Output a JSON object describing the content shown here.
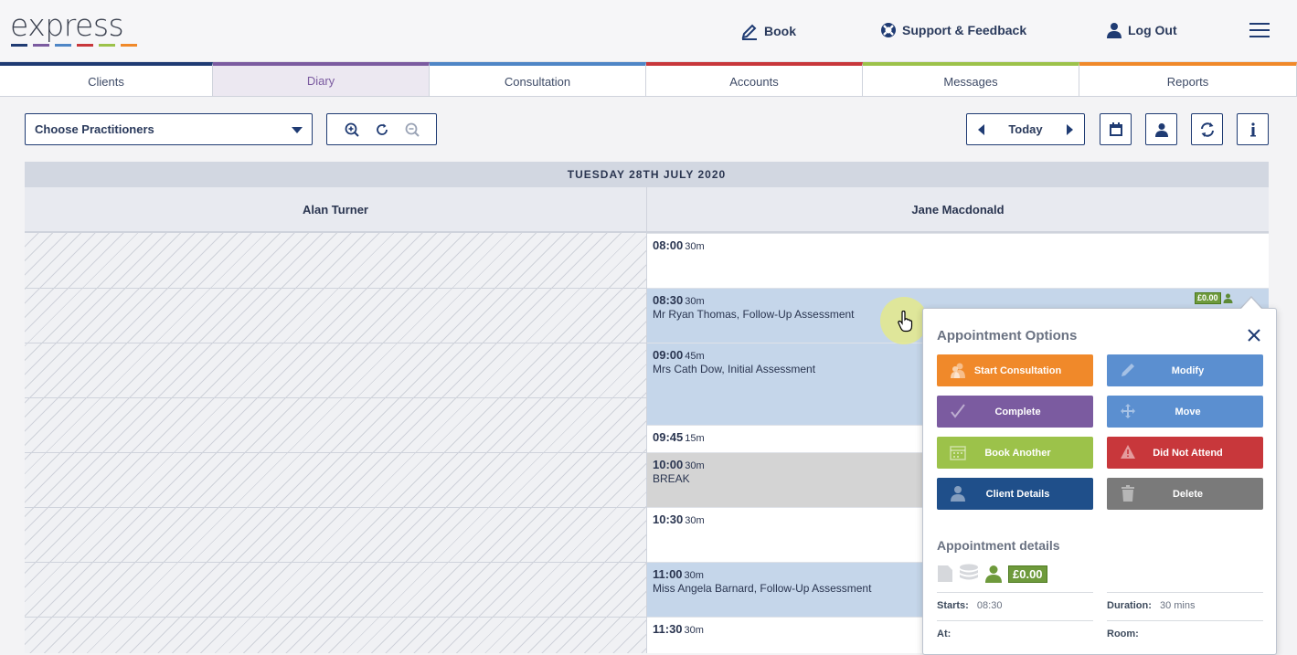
{
  "header": {
    "logo_text": "express",
    "logo_colors": [
      "#1f3b73",
      "#7b5ba0",
      "#4f86c6",
      "#c8373b",
      "#9cc24a",
      "#f0892a"
    ],
    "book_label": "Book",
    "support_label": "Support & Feedback",
    "logout_label": "Log Out"
  },
  "tabs": [
    {
      "label": "Clients",
      "color": "#1f3b73"
    },
    {
      "label": "Diary",
      "color": "#7b5ba0"
    },
    {
      "label": "Consultation",
      "color": "#4f86c6"
    },
    {
      "label": "Accounts",
      "color": "#c8373b"
    },
    {
      "label": "Messages",
      "color": "#9cc24a"
    },
    {
      "label": "Reports",
      "color": "#f0892a"
    }
  ],
  "toolbar": {
    "practitioner_select": "Choose Practitioners",
    "today_label": "Today"
  },
  "diary": {
    "date": "TUESDAY 28TH JULY 2020",
    "practitioners": [
      "Alan Turner",
      "Jane Macdonald"
    ],
    "slots": [
      {
        "time": "08:00",
        "dur": "30m",
        "desc": ""
      },
      {
        "time": "08:30",
        "dur": "30m",
        "desc": "Mr Ryan Thomas, Follow-Up Assessment"
      },
      {
        "time": "09:00",
        "dur": "45m",
        "desc": "Mrs Cath Dow, Initial Assessment"
      },
      {
        "time": "09:45",
        "dur": "15m",
        "desc": ""
      },
      {
        "time": "10:00",
        "dur": "30m",
        "desc": "BREAK"
      },
      {
        "time": "10:30",
        "dur": "30m",
        "desc": ""
      },
      {
        "time": "11:00",
        "dur": "30m",
        "desc": "Miss Angela Barnard, Follow-Up Assessment"
      },
      {
        "time": "11:30",
        "dur": "30m",
        "desc": ""
      }
    ],
    "badge_price": "£0.00"
  },
  "popover": {
    "title": "Appointment Options",
    "options": [
      {
        "label": "Start Consultation",
        "color": "#f0892a",
        "icon": "people-icon"
      },
      {
        "label": "Modify",
        "color": "#5b8fd0",
        "icon": "pencil-icon"
      },
      {
        "label": "Complete",
        "color": "#7b5ba0",
        "icon": "check-icon"
      },
      {
        "label": "Move",
        "color": "#5b8fd0",
        "icon": "move-icon"
      },
      {
        "label": "Book Another",
        "color": "#9cc24a",
        "icon": "calendar-icon"
      },
      {
        "label": "Did Not Attend",
        "color": "#c8373b",
        "icon": "warning-icon"
      },
      {
        "label": "Client Details",
        "color": "#1f4f8a",
        "icon": "user-icon"
      },
      {
        "label": "Delete",
        "color": "#7a7a7a",
        "icon": "trash-icon"
      }
    ],
    "details_title": "Appointment details",
    "price": "£0.00",
    "starts_label": "Starts:",
    "starts_value": "08:30",
    "duration_label": "Duration:",
    "duration_value": "30 mins",
    "at_label": "At:",
    "room_label": "Room:"
  }
}
